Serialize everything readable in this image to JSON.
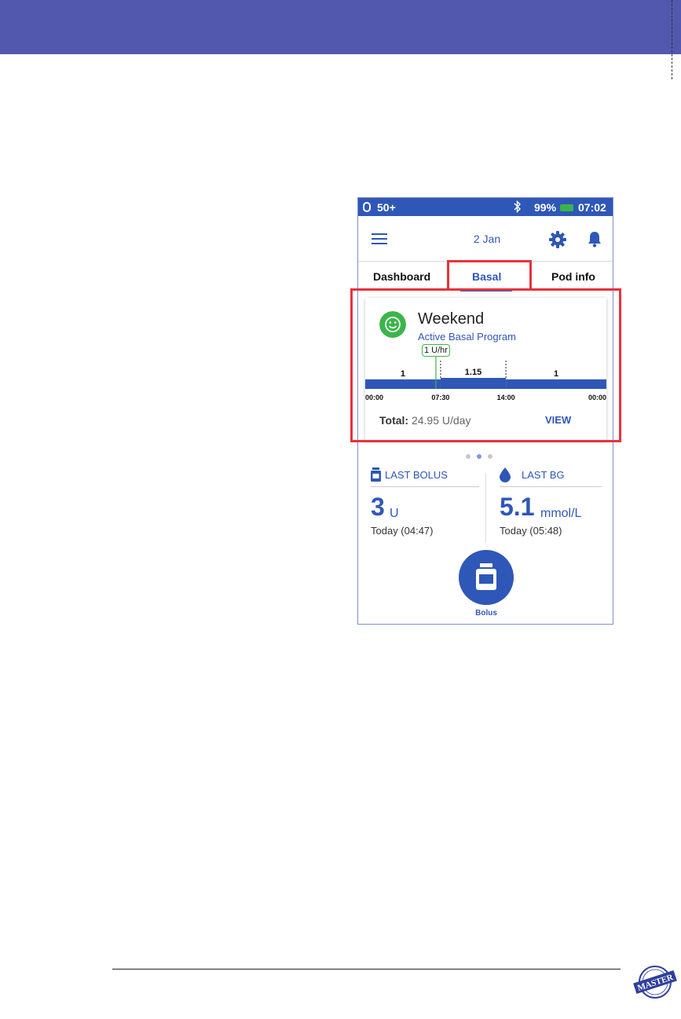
{
  "colors": {
    "band": "#5158ae",
    "primary": "#2f57b8",
    "green": "#3bb54a",
    "highlight": "#e8323a",
    "dot_inactive": "#c8c8c8",
    "dot_active": "#7d9bd6"
  },
  "stamp": {
    "text": "MASTER"
  },
  "status_bar": {
    "pods_count": "50+",
    "bluetooth_icon": "bluetooth-icon",
    "battery_percent": "99%",
    "time": "07:02"
  },
  "app_bar": {
    "menu_icon": "hamburger-menu-icon",
    "date": "2 Jan",
    "settings_icon": "gear-icon",
    "notifications_icon": "bell-icon"
  },
  "tabs": [
    {
      "label": "Dashboard",
      "active": false
    },
    {
      "label": "Basal",
      "active": true
    },
    {
      "label": "Pod info",
      "active": false
    }
  ],
  "basal_card": {
    "status_icon": "smiley-icon",
    "program_name": "Weekend",
    "program_status": "Active Basal Program",
    "current_rate": "1 U/hr",
    "current_time": "07:30",
    "segments": [
      {
        "label": "1",
        "start": "00:00",
        "end": "07:30",
        "rate": 1
      },
      {
        "label": "1.15",
        "start": "07:30",
        "end": "14:00",
        "rate": 1.15
      },
      {
        "label": "1",
        "start": "14:00",
        "end": "00:00",
        "rate": 1
      }
    ],
    "time_labels": [
      "00:00",
      "07:30",
      "14:00",
      "00:00"
    ],
    "total_label": "Total:",
    "total_value": "24.95 U/day",
    "view_label": "VIEW"
  },
  "page_dots": {
    "count": 3,
    "active_index": 1
  },
  "last_bolus": {
    "icon": "insulin-vial-icon",
    "title": "LAST BOLUS",
    "value": "3",
    "unit": "U",
    "time": "Today (04:47)"
  },
  "last_bg": {
    "icon": "blood-drop-icon",
    "title": "LAST BG",
    "value": "5.1",
    "unit": "mmol/L",
    "time": "Today (05:48)"
  },
  "bolus_button": {
    "icon": "insulin-vial-icon",
    "label": "Bolus"
  }
}
